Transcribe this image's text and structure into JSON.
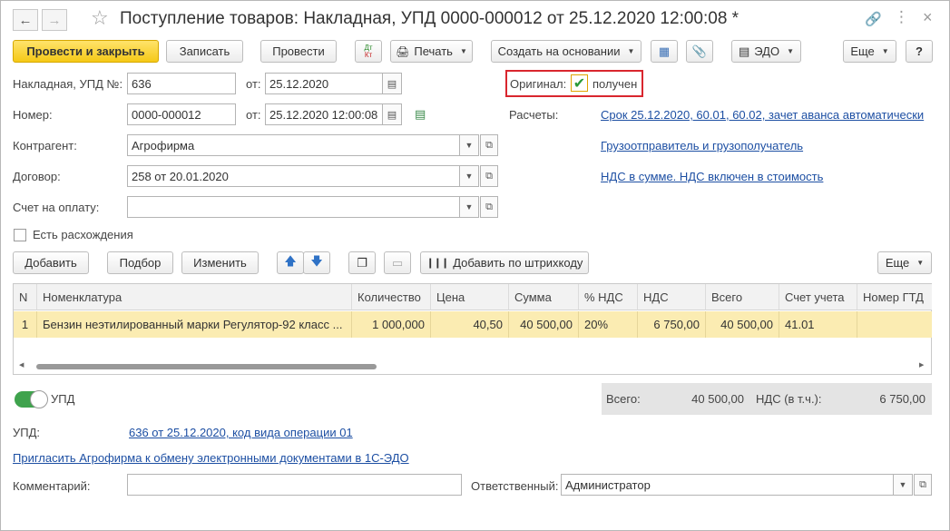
{
  "title": "Поступление товаров: Накладная, УПД 0000-000012 от 25.12.2020 12:00:08 *",
  "toolbar": {
    "post_close": "Провести и закрыть",
    "save": "Записать",
    "post": "Провести",
    "print": "Печать",
    "create_based": "Создать на основании",
    "edo": "ЭДО",
    "more": "Еще",
    "help": "?"
  },
  "form": {
    "invoice_label": "Накладная, УПД №:",
    "invoice_value": "636",
    "from_label": "от:",
    "invoice_date": "25.12.2020",
    "number_label": "Номер:",
    "number_value": "0000-000012",
    "number_date": "25.12.2020 12:00:08",
    "counterparty_label": "Контрагент:",
    "counterparty_value": "Агрофирма",
    "contract_label": "Договор:",
    "contract_value": "258 от 20.01.2020",
    "invoice_pay_label": "Счет на оплату:",
    "invoice_pay_value": "",
    "discrepancy_label": "Есть расхождения",
    "original_label": "Оригинал:",
    "original_received": "получен",
    "settlements_label": "Расчеты:",
    "settlements_link": "Срок 25.12.2020, 60.01, 60.02, зачет аванса автоматически",
    "shipper_link": "Грузоотправитель и грузополучатель",
    "vat_link": "НДС в сумме. НДС включен в стоимость"
  },
  "table_toolbar": {
    "add": "Добавить",
    "pick": "Подбор",
    "change": "Изменить",
    "barcode": "Добавить по штрихкоду",
    "more": "Еще"
  },
  "table": {
    "headers": [
      "N",
      "Номенклатура",
      "Количество",
      "Цена",
      "Сумма",
      "% НДС",
      "НДС",
      "Всего",
      "Счет учета",
      "Номер ГТД"
    ],
    "rows": [
      [
        "1",
        "Бензин неэтилированный марки Регулятор-92 класс ...",
        "1 000,000",
        "40,50",
        "40 500,00",
        "20%",
        "6 750,00",
        "40 500,00",
        "41.01",
        ""
      ]
    ]
  },
  "footer": {
    "upd_toggle": "УПД",
    "total_label": "Всего:",
    "total_value": "40 500,00",
    "vat_label": "НДС (в т.ч.):",
    "vat_value": "6 750,00",
    "upd_label": "УПД:",
    "upd_link": "636 от 25.12.2020, код вида операции 01",
    "invite_link": "Пригласить Агрофирма к обмену электронными документами в 1С-ЭДО",
    "comment_label": "Комментарий:",
    "comment_value": "",
    "responsible_label": "Ответственный:",
    "responsible_value": "Администратор"
  },
  "colors": {
    "primary_button": "#f5c917",
    "selected_row": "#fbecb2",
    "link": "#1d4fa3",
    "highlight_border": "#d9262e",
    "toggle_on": "#3fa34d"
  }
}
